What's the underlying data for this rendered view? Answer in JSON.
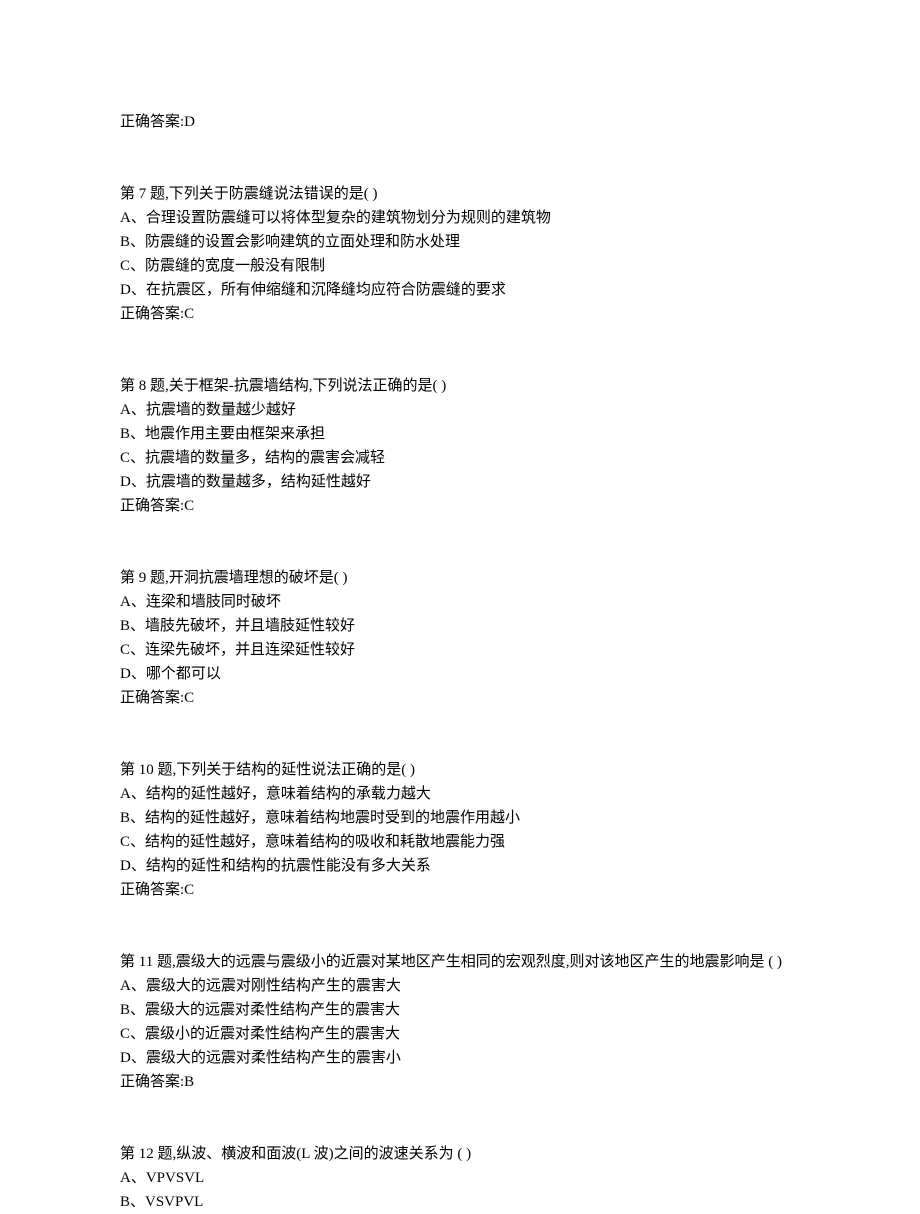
{
  "prev_answer": "正确答案:D",
  "questions": [
    {
      "title": "第 7 题,下列关于防震缝说法错误的是(         )",
      "options": [
        "A、合理设置防震缝可以将体型复杂的建筑物划分为规则的建筑物",
        "B、防震缝的设置会影响建筑的立面处理和防水处理",
        "C、防震缝的宽度一般没有限制",
        "D、在抗震区，所有伸缩缝和沉降缝均应符合防震缝的要求"
      ],
      "answer": "正确答案:C"
    },
    {
      "title": "第 8 题,关于框架-抗震墙结构,下列说法正确的是(         )",
      "options": [
        "A、抗震墙的数量越少越好",
        "B、地震作用主要由框架来承担",
        "C、抗震墙的数量多，结构的震害会减轻",
        "D、抗震墙的数量越多，结构延性越好"
      ],
      "answer": "正确答案:C"
    },
    {
      "title": "第 9 题,开洞抗震墙理想的破坏是(           )",
      "options": [
        "A、连梁和墙肢同时破坏",
        "B、墙肢先破坏，并且墙肢延性较好",
        "C、连梁先破坏，并且连梁延性较好",
        "D、哪个都可以"
      ],
      "answer": "正确答案:C"
    },
    {
      "title": "第 10 题,下列关于结构的延性说法正确的是(           )",
      "options": [
        "A、结构的延性越好，意味着结构的承载力越大",
        "B、结构的延性越好，意味着结构地震时受到的地震作用越小",
        "C、结构的延性越好，意味着结构的吸收和耗散地震能力强",
        "D、结构的延性和结构的抗震性能没有多大关系"
      ],
      "answer": "正确答案:C"
    },
    {
      "title": "第 11 题,震级大的远震与震级小的近震对某地区产生相同的宏观烈度,则对该地区产生的地震影响是                                         (         )",
      "options": [
        "A、震级大的远震对刚性结构产生的震害大",
        "B、震级大的远震对柔性结构产生的震害大",
        "C、震级小的近震对柔性结构产生的震害大",
        "D、震级大的远震对柔性结构产生的震害小"
      ],
      "answer": "正确答案:B"
    },
    {
      "title": "第 12 题,纵波、横波和面波(L 波)之间的波速关系为                         (        )",
      "options": [
        "A、VPVSVL",
        "B、VSVPVL"
      ],
      "answer": ""
    }
  ]
}
